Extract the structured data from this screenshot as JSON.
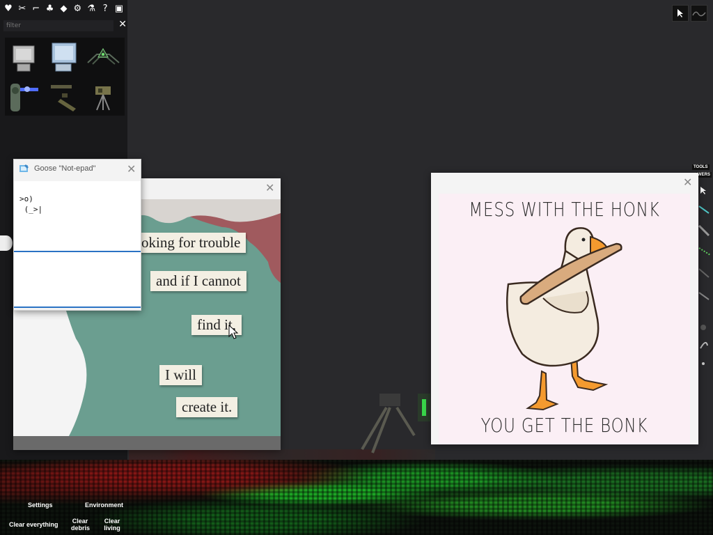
{
  "toolbar": {
    "icons": [
      "heart-icon",
      "wrench-icon",
      "gun-icon",
      "plant-icon",
      "vehicle-icon",
      "gear-icon",
      "flask-icon",
      "help-icon",
      "save-icon"
    ],
    "glyphs": [
      "♥",
      "✂",
      "⌐",
      "♣",
      "◆",
      "⚙",
      "⚗",
      "?",
      "▣"
    ]
  },
  "filter": {
    "placeholder": "filter",
    "clear_label": "✕"
  },
  "bottom_menu": {
    "settings": "Settings",
    "environment": "Environment",
    "clear_everything": "Clear everything",
    "clear_debris": "Clear debris",
    "clear_living": "Clear living"
  },
  "right_strip": {
    "tools_label": "TOOLS",
    "powers_label": "WERS"
  },
  "notepad": {
    "title": "Goose \"Not-epad\"",
    "close": "✕",
    "text": ">o)\n (_>|"
  },
  "poem": {
    "close": "✕",
    "lines": [
      "oking for trouble",
      "and if I cannot",
      "find it,",
      "I will",
      "create it."
    ]
  },
  "meme": {
    "close": "✕",
    "top_text": "MESS WITH THE HONK",
    "bottom_text": "YOU GET THE BONK"
  }
}
